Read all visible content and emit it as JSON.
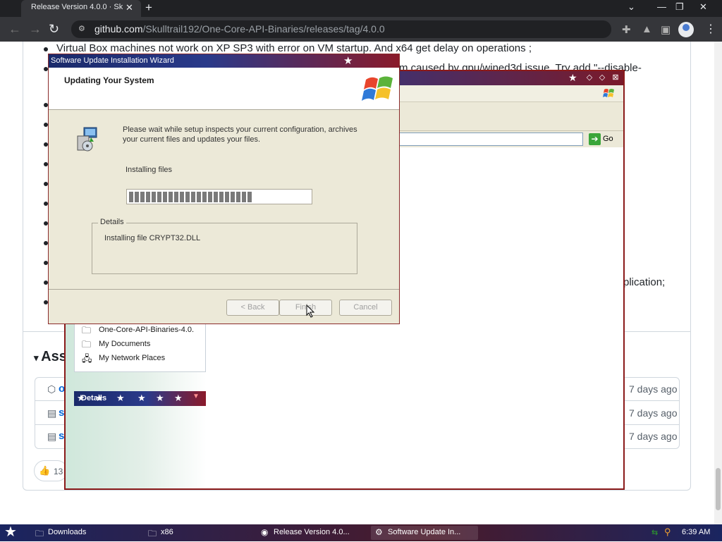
{
  "browser": {
    "tab_title": "Release Version 4.0.0 · Sk",
    "url_host": "github.com",
    "url_path": "/Skulltrail192/One-Core-API-Binaries/releases/tag/4.0.0"
  },
  "page": {
    "note_line1": "Virtual Box machines not work on XP SP3 with error on VM startup. And x64 get delay on operations ;",
    "note_line2": "m caused by gpu/wined3d issue. Try add \"--disable-",
    "note_line3": "plication;",
    "assets_heading": "Ass",
    "asset_rows": [
      {
        "icon": "package-icon",
        "name": "o",
        "date": "7 days ago"
      },
      {
        "icon": "zip-icon",
        "name": "s",
        "date": "7 days ago"
      },
      {
        "icon": "zip-icon",
        "name": "s",
        "date": "7 days ago"
      }
    ],
    "reaction_count": "13"
  },
  "explorer": {
    "go_label": "Go",
    "places": [
      "One-Core-API-Binaries-4.0.",
      "My Documents",
      "My Network Places"
    ],
    "details_label": "Details"
  },
  "dialog": {
    "title": "Software Update Installation Wizard",
    "heading": "Updating Your System",
    "description": "Please wait while setup inspects your current configuration, archives your current files and updates your files.",
    "status": "Installing files",
    "progress": 0.68,
    "details_legend": "Details",
    "details_text": "Installing file CRYPT32.DLL",
    "back_label": "< Back",
    "finish_label": "Finish",
    "cancel_label": "Cancel"
  },
  "taskbar": {
    "tasks": [
      {
        "icon": "folder-icon",
        "label": "Downloads"
      },
      {
        "icon": "folder-icon",
        "label": "x86"
      },
      {
        "icon": "chrome-icon",
        "label": "Release Version 4.0..."
      },
      {
        "icon": "setup-icon",
        "label": "Software Update In..."
      }
    ],
    "clock": "6:39 AM"
  },
  "colors": {
    "accent_blue": "#0969da",
    "xp_title_blue": "#1a2a6a",
    "xp_title_red": "#8a1a2a"
  }
}
